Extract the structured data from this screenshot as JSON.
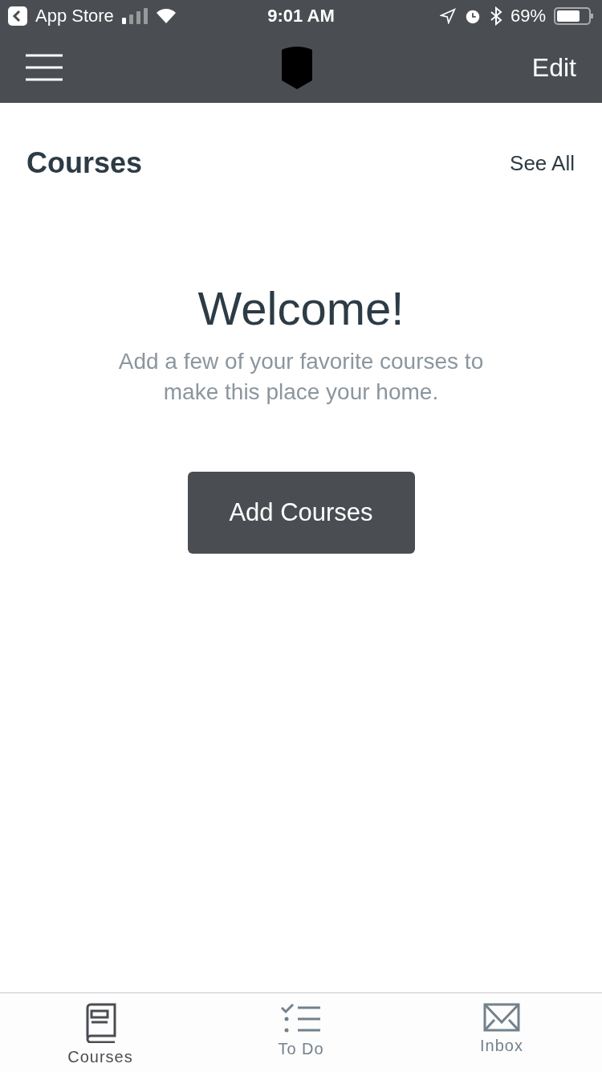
{
  "status_bar": {
    "back_app": "App Store",
    "time": "9:01 AM",
    "battery": "69%"
  },
  "nav_bar": {
    "action": "Edit"
  },
  "section": {
    "title": "Courses",
    "link": "See All"
  },
  "empty_state": {
    "heading": "Welcome!",
    "message": "Add a few of your favorite courses to make this place your home.",
    "button": "Add Courses"
  },
  "tab_bar": [
    {
      "kind": "book",
      "label": "Courses",
      "selected": true
    },
    {
      "kind": "todo",
      "label": "To Do",
      "selected": false
    },
    {
      "kind": "mail",
      "label": "Inbox",
      "selected": false
    }
  ]
}
